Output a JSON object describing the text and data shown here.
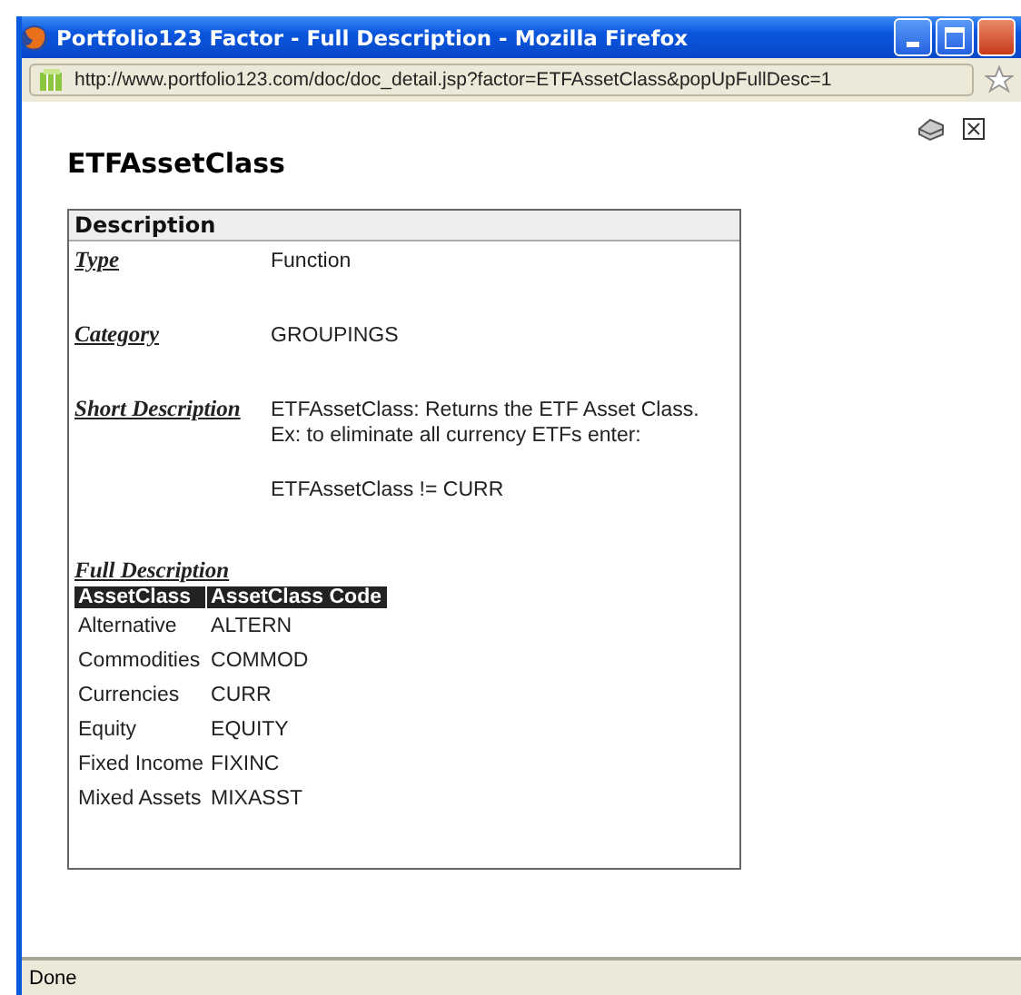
{
  "window": {
    "title": "Portfolio123 Factor - Full Description - Mozilla Firefox"
  },
  "address_bar": {
    "url": "http://www.portfolio123.com/doc/doc_detail.jsp?factor=ETFAssetClass&popUpFullDesc=1"
  },
  "page": {
    "heading": "ETFAssetClass",
    "description": {
      "header": "Description",
      "fields": [
        {
          "label": "Type",
          "lines": [
            "Function"
          ]
        },
        {
          "label": "Category",
          "lines": [
            "GROUPINGS"
          ]
        },
        {
          "label": "Short Description",
          "lines": [
            "ETFAssetClass: Returns the ETF Asset Class.",
            "Ex: to eliminate all currency ETFs enter:"
          ],
          "example": "ETFAssetClass != CURR"
        }
      ],
      "full_description": {
        "label": "Full Description",
        "columns": [
          "AssetClass",
          "AssetClass Code"
        ],
        "rows": [
          [
            "Alternative",
            "ALTERN"
          ],
          [
            "Commodities",
            "COMMOD"
          ],
          [
            "Currencies",
            "CURR"
          ],
          [
            "Equity",
            "EQUITY"
          ],
          [
            "Fixed Income",
            "FIXINC"
          ],
          [
            "Mixed Assets",
            "MIXASST"
          ]
        ]
      }
    }
  },
  "status_bar": {
    "text": "Done"
  }
}
